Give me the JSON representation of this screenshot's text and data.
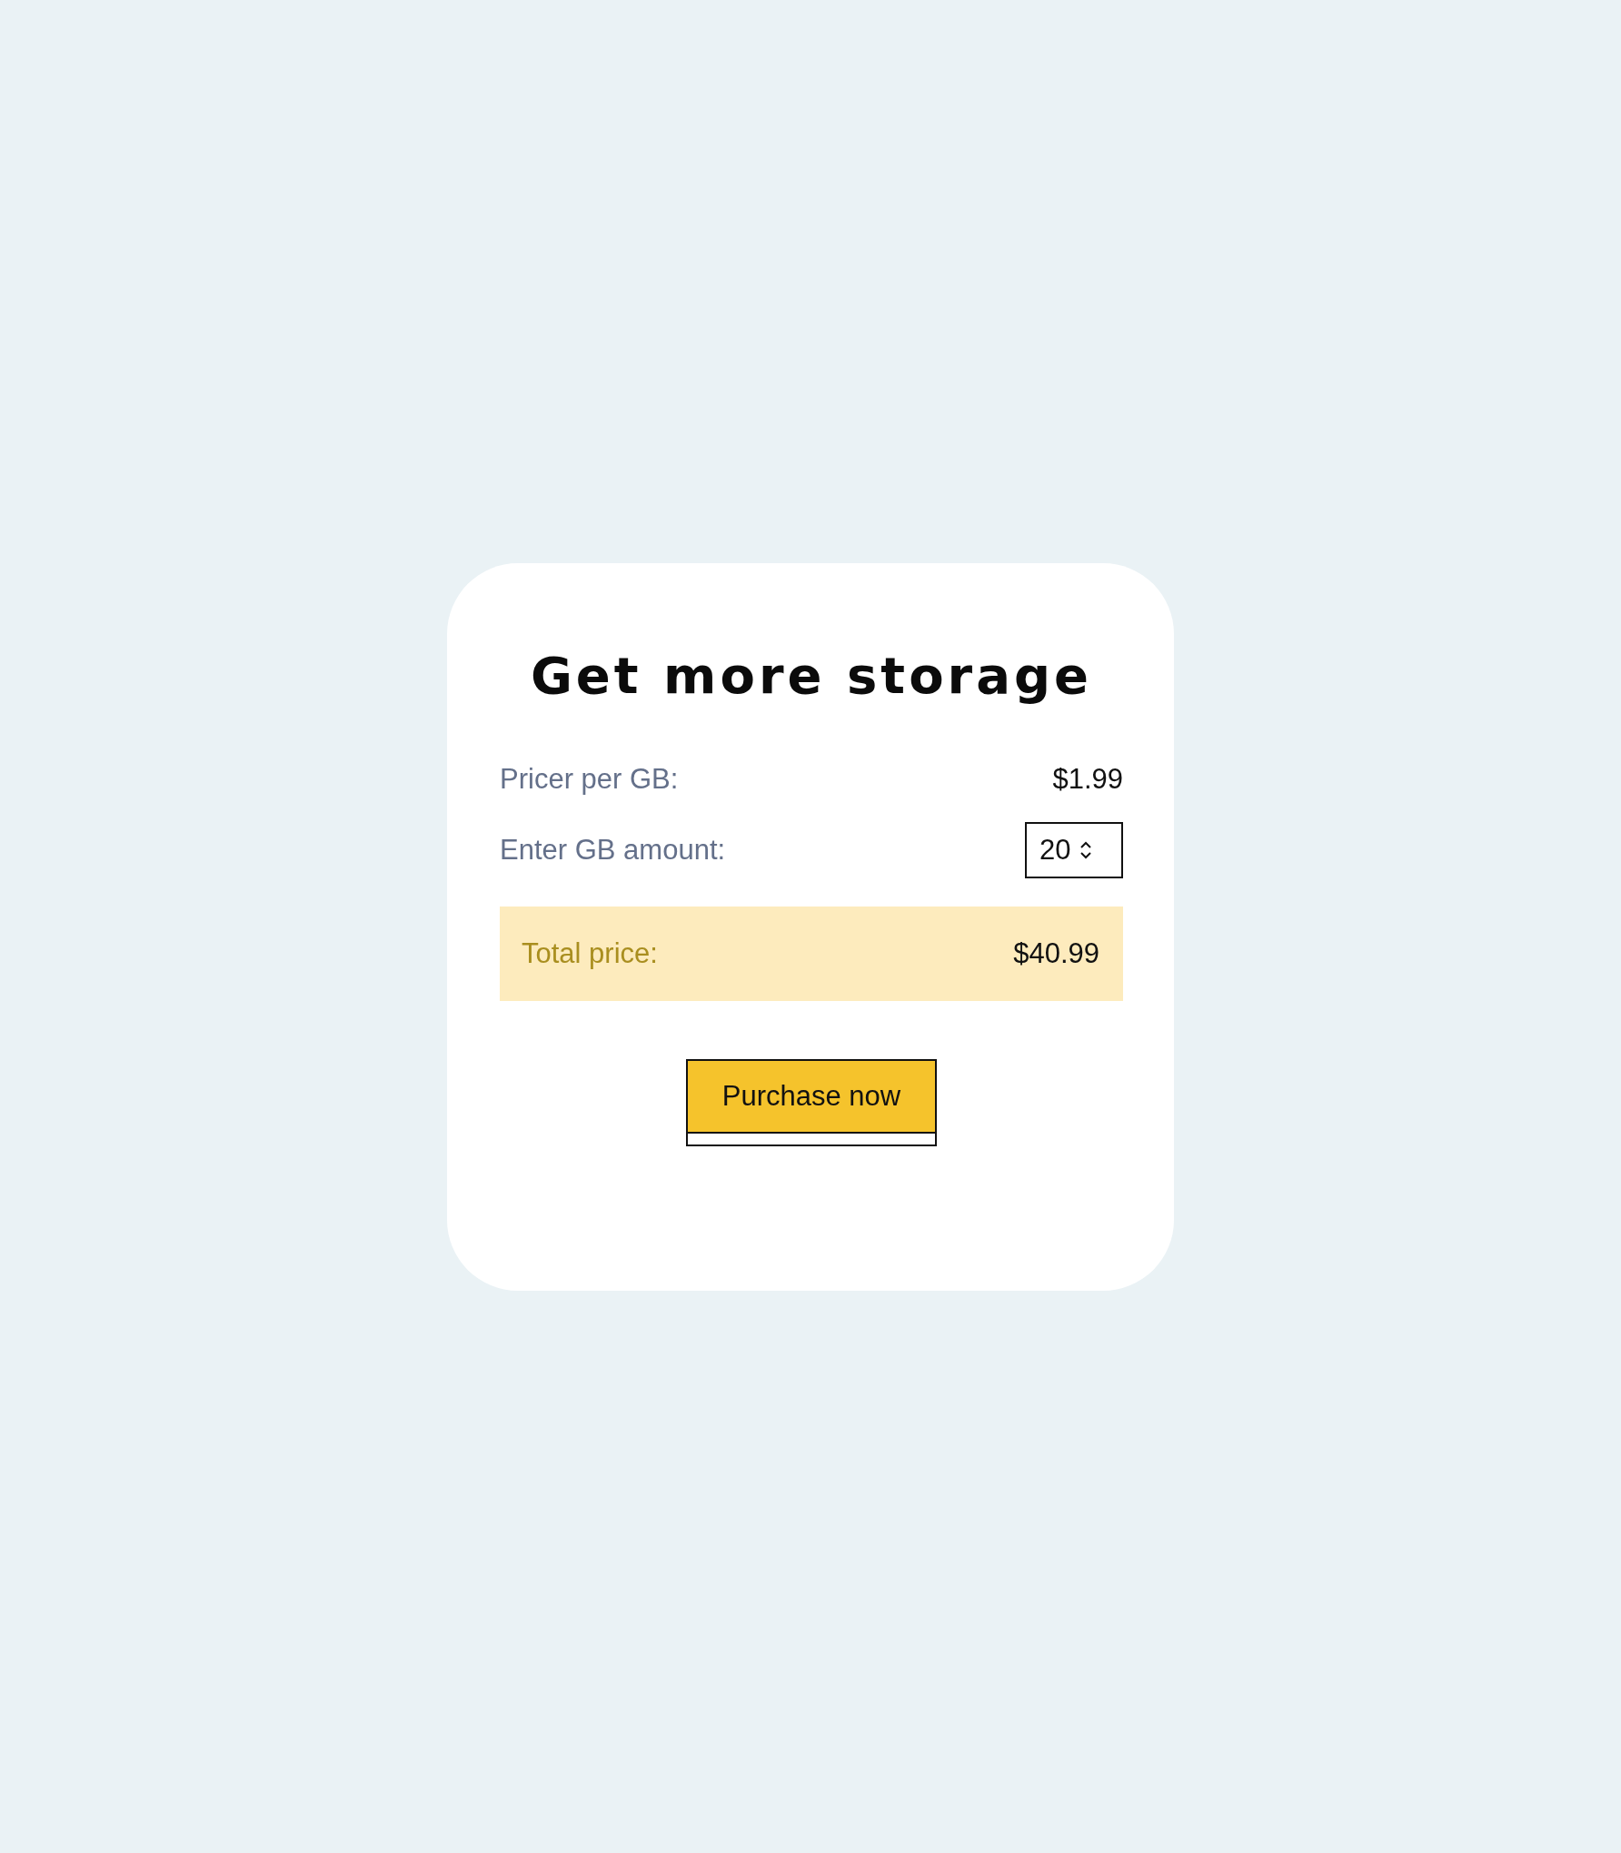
{
  "title": "Get more storage",
  "rows": [
    {
      "label": "Pricer per GB:",
      "kind": "text",
      "value": "$1.99"
    },
    {
      "label": "Enter GB amount:",
      "kind": "number",
      "value": "20"
    }
  ],
  "total": {
    "label": "Total price:",
    "value": "$40.99"
  },
  "button": "Purchase now"
}
